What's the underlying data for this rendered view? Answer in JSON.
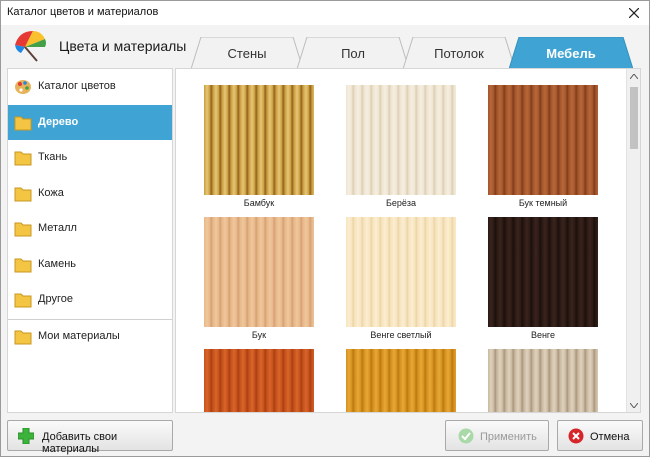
{
  "window": {
    "title": "Каталог цветов и материалов"
  },
  "header": {
    "title": "Цвета и материалы"
  },
  "tabs": [
    {
      "label": "Стены",
      "active": false
    },
    {
      "label": "Пол",
      "active": false
    },
    {
      "label": "Потолок",
      "active": false
    },
    {
      "label": "Мебель",
      "active": true
    }
  ],
  "sidebar": {
    "items": [
      {
        "label": "Каталог цветов",
        "icon": "palette-icon",
        "active": false
      },
      {
        "label": "Дерево",
        "icon": "folder-icon",
        "active": true
      },
      {
        "label": "Ткань",
        "icon": "folder-icon",
        "active": false
      },
      {
        "label": "Кожа",
        "icon": "folder-icon",
        "active": false
      },
      {
        "label": "Металл",
        "icon": "folder-icon",
        "active": false
      },
      {
        "label": "Камень",
        "icon": "folder-icon",
        "active": false
      },
      {
        "label": "Другое",
        "icon": "folder-icon",
        "active": false
      },
      {
        "label": "Мои материалы",
        "icon": "folder-icon",
        "active": false
      }
    ]
  },
  "materials": [
    {
      "label": "Бамбук",
      "colors": [
        "#c99a3c",
        "#e6c877",
        "#8a5e1e"
      ]
    },
    {
      "label": "Берёза",
      "colors": [
        "#ede3d0",
        "#f6efe2",
        "#dccdb2"
      ]
    },
    {
      "label": "Бук темный",
      "colors": [
        "#a2552a",
        "#b8683a",
        "#7c3a1a"
      ]
    },
    {
      "label": "Бук",
      "colors": [
        "#e7b78a",
        "#f0c79c",
        "#d39f70"
      ]
    },
    {
      "label": "Венге светлый",
      "colors": [
        "#f7e4bf",
        "#fbedcf",
        "#ecd3a6"
      ]
    },
    {
      "label": "Венге",
      "colors": [
        "#2a1914",
        "#3a231c",
        "#1a0e0a"
      ]
    },
    {
      "label": "",
      "colors": [
        "#c4501c",
        "#d9652a",
        "#a83f12"
      ]
    },
    {
      "label": "",
      "colors": [
        "#d4901e",
        "#e7a836",
        "#b9770f"
      ]
    },
    {
      "label": "",
      "colors": [
        "#c9b8a0",
        "#ded2be",
        "#a8937a"
      ]
    }
  ],
  "buttons": {
    "add": "Добавить свои материалы",
    "apply": "Применить",
    "cancel": "Отмена"
  },
  "colors": {
    "accent": "#3fa3d3",
    "tab_inactive": "#f2f2f2",
    "add_icon": "#3cb43c",
    "cancel_icon": "#d7262a",
    "apply_icon_disabled": "#a9d9a9"
  }
}
